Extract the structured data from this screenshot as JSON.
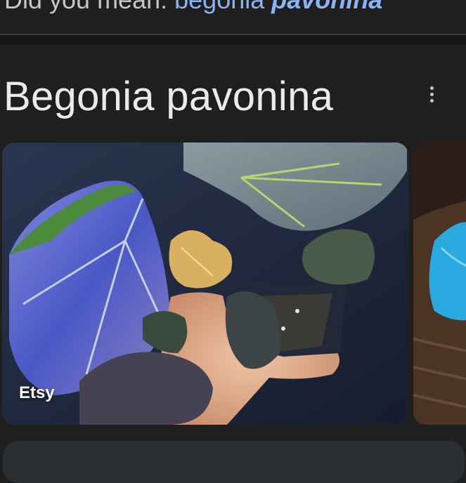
{
  "did_you_mean": {
    "prefix": "Did you mean: ",
    "suggestion_plain": "begonia ",
    "suggestion_bold": "pavonina"
  },
  "knowledge_panel": {
    "title": "Begonia pavonina",
    "more_icon": "more-vert-icon",
    "images": [
      {
        "source": "Etsy"
      },
      {
        "source": ""
      }
    ]
  },
  "colors": {
    "background": "#1f1f1f",
    "title_text": "#e8eaed",
    "link": "#8ab4f8"
  }
}
